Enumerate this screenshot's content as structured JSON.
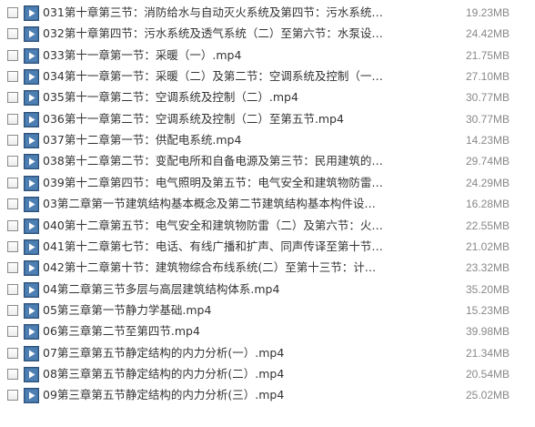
{
  "files": [
    {
      "name": "031第十章第三节：消防给水与自动灭火系统及第四节：污水系统及...",
      "size": "19.23MB"
    },
    {
      "name": "032第十章第四节：污水系统及透气系统（二）至第六节：水泵设.m...",
      "size": "24.42MB"
    },
    {
      "name": "033第十一章第一节：采暖（一）.mp4",
      "size": "21.75MB"
    },
    {
      "name": "034第十一章第一节：采暖（二）及第二节：空调系统及控制（一）....",
      "size": "27.10MB"
    },
    {
      "name": "035第十一章第二节：空调系统及控制（二）.mp4",
      "size": "30.77MB"
    },
    {
      "name": "036第十一章第二节：空调系统及控制（二）至第五节.mp4",
      "size": "30.77MB"
    },
    {
      "name": "037第十二章第一节：供配电系统.mp4",
      "size": "14.23MB"
    },
    {
      "name": "038第十二章第二节：变配电所和自备电源及第三节：民用建筑的配...",
      "size": "29.74MB"
    },
    {
      "name": "039第十二章第四节：电气照明及第五节：电气安全和建筑物防雷(一...",
      "size": "24.29MB"
    },
    {
      "name": "03第二章第一节建筑结构基本概念及第二节建筑结构基本构件设计....",
      "size": "16.28MB"
    },
    {
      "name": "040第十二章第五节：电气安全和建筑物防雷（二）及第六节：火.m...",
      "size": "22.55MB"
    },
    {
      "name": "041第十二章第七节：电话、有线广播和扩声、同声传译至第十节：...",
      "size": "21.02MB"
    },
    {
      "name": "042第十二章第十节：建筑物综合布线系统(二）至第十三节：计算机...",
      "size": "23.32MB"
    },
    {
      "name": "04第二章第三节多层与高层建筑结构体系.mp4",
      "size": "35.20MB"
    },
    {
      "name": "05第三章第一节静力学基础.mp4",
      "size": "15.23MB"
    },
    {
      "name": "06第三章第二节至第四节.mp4",
      "size": "39.98MB"
    },
    {
      "name": "07第三章第五节静定结构的内力分析(一）.mp4",
      "size": "21.34MB"
    },
    {
      "name": "08第三章第五节静定结构的内力分析(二）.mp4",
      "size": "20.54MB"
    },
    {
      "name": "09第三章第五节静定结构的内力分析(三）.mp4",
      "size": "25.02MB"
    }
  ],
  "icon": "video-file-icon",
  "colors": {
    "icon_frame": "#3f6fa0",
    "icon_play": "#ffffff",
    "name_text": "#333333",
    "size_text": "#888888"
  }
}
